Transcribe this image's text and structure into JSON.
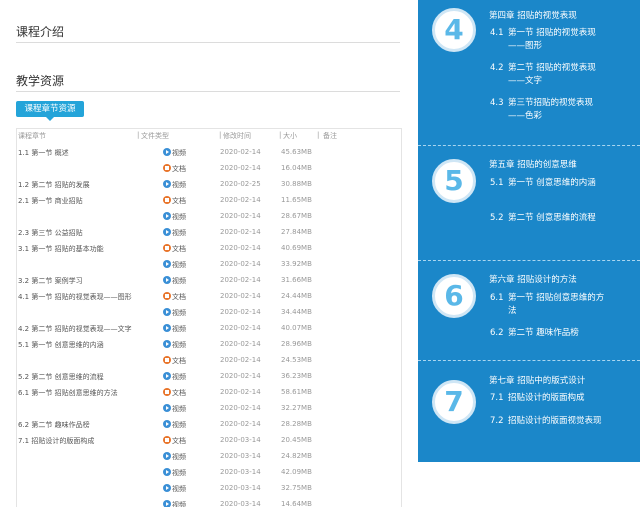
{
  "page": {
    "intro_title": "课程介绍",
    "resources_title": "教学资源",
    "tab_label": "课程章节资源"
  },
  "table": {
    "headers": [
      "课程章节",
      "文件类型",
      "修改时间",
      "大小",
      "备注"
    ],
    "rows": [
      {
        "name": "1.1 第一节 概述",
        "type": "视频",
        "icon": "video",
        "date": "2020-02-14",
        "size": "45.63MB"
      },
      {
        "name": "",
        "type": "文档",
        "icon": "doc",
        "date": "2020-02-14",
        "size": "16.04MB"
      },
      {
        "name": "1.2 第二节 招贴的发展",
        "type": "视频",
        "icon": "video",
        "date": "2020-02-25",
        "size": "30.88MB"
      },
      {
        "name": "2.1 第一节 商业招贴",
        "type": "文档",
        "icon": "doc",
        "date": "2020-02-14",
        "size": "11.65MB"
      },
      {
        "name": "",
        "type": "视频",
        "icon": "video",
        "date": "2020-02-14",
        "size": "28.67MB"
      },
      {
        "name": "2.3 第三节 公益招贴",
        "type": "视频",
        "icon": "video",
        "date": "2020-02-14",
        "size": "27.84MB"
      },
      {
        "name": "3.1 第一节 招贴的基本功能",
        "type": "文档",
        "icon": "doc",
        "date": "2020-02-14",
        "size": "40.69MB"
      },
      {
        "name": "",
        "type": "视频",
        "icon": "video",
        "date": "2020-02-14",
        "size": "33.92MB"
      },
      {
        "name": "3.2 第二节 案例学习",
        "type": "视频",
        "icon": "video",
        "date": "2020-02-14",
        "size": "31.66MB"
      },
      {
        "name": "4.1 第一节 招贴的视觉表现——图形",
        "type": "文档",
        "icon": "doc",
        "date": "2020-02-14",
        "size": "24.44MB"
      },
      {
        "name": "",
        "type": "视频",
        "icon": "video",
        "date": "2020-02-14",
        "size": "34.44MB"
      },
      {
        "name": "4.2 第二节 招贴的视觉表现——文字",
        "type": "视频",
        "icon": "video",
        "date": "2020-02-14",
        "size": "40.07MB"
      },
      {
        "name": "5.1 第一节 创意思维的内涵",
        "type": "视频",
        "icon": "video",
        "date": "2020-02-14",
        "size": "28.96MB"
      },
      {
        "name": "",
        "type": "文档",
        "icon": "doc",
        "date": "2020-02-14",
        "size": "24.53MB"
      },
      {
        "name": "5.2 第二节 创意思维的流程",
        "type": "视频",
        "icon": "video",
        "date": "2020-02-14",
        "size": "36.23MB"
      },
      {
        "name": "6.1 第一节 招贴创意思维的方法",
        "type": "文档",
        "icon": "doc",
        "date": "2020-02-14",
        "size": "58.61MB"
      },
      {
        "name": "",
        "type": "视频",
        "icon": "video",
        "date": "2020-02-14",
        "size": "32.27MB"
      },
      {
        "name": "6.2 第二节 趣味作品榜",
        "type": "视频",
        "icon": "video",
        "date": "2020-02-14",
        "size": "28.28MB"
      },
      {
        "name": "7.1 招贴设计的版面构成",
        "type": "文档",
        "icon": "doc",
        "date": "2020-03-14",
        "size": "20.45MB"
      },
      {
        "name": "",
        "type": "视频",
        "icon": "video",
        "date": "2020-03-14",
        "size": "24.82MB"
      },
      {
        "name": "",
        "type": "视频",
        "icon": "video",
        "date": "2020-03-14",
        "size": "42.09MB"
      },
      {
        "name": "",
        "type": "视频",
        "icon": "video",
        "date": "2020-03-14",
        "size": "32.75MB"
      },
      {
        "name": "",
        "type": "视频",
        "icon": "video",
        "date": "2020-03-14",
        "size": "14.64MB"
      }
    ]
  },
  "chapters": [
    {
      "number": "4",
      "title": "第四章 招贴的视觉表现",
      "sections": [
        {
          "num": "4.1",
          "text": "第一节 招贴的视觉表现——图形"
        },
        {
          "num": "4.2",
          "text": "第二节 招贴的视觉表现——文字"
        },
        {
          "num": "4.3",
          "text": "第三节招贴的视觉表现——色彩"
        }
      ]
    },
    {
      "number": "5",
      "title": "第五章 招贴的创意思维",
      "sections": [
        {
          "num": "5.1",
          "text": "第一节 创意思维的内涵"
        },
        {
          "num": "5.2",
          "text": "第二节 创意思维的流程"
        }
      ]
    },
    {
      "number": "6",
      "title": "第六章 招贴设计的方法",
      "sections": [
        {
          "num": "6.1",
          "text": "第一节 招贴创意思维的方法"
        },
        {
          "num": "6.2",
          "text": "第二节 趣味作品榜"
        }
      ]
    },
    {
      "number": "7",
      "title": "第七章 招贴中的版式设计",
      "sections": [
        {
          "num": "7.1",
          "text": "招贴设计的版面构成"
        },
        {
          "num": "7.2",
          "text": "招贴设计的版面视觉表现"
        }
      ]
    }
  ],
  "colors": {
    "panel_blue": "#1b87c9",
    "tab_blue": "#24a4d9",
    "circle_number": "#5ab8e8",
    "video_icon": "#3a8fd6",
    "doc_icon": "#e8742a"
  }
}
